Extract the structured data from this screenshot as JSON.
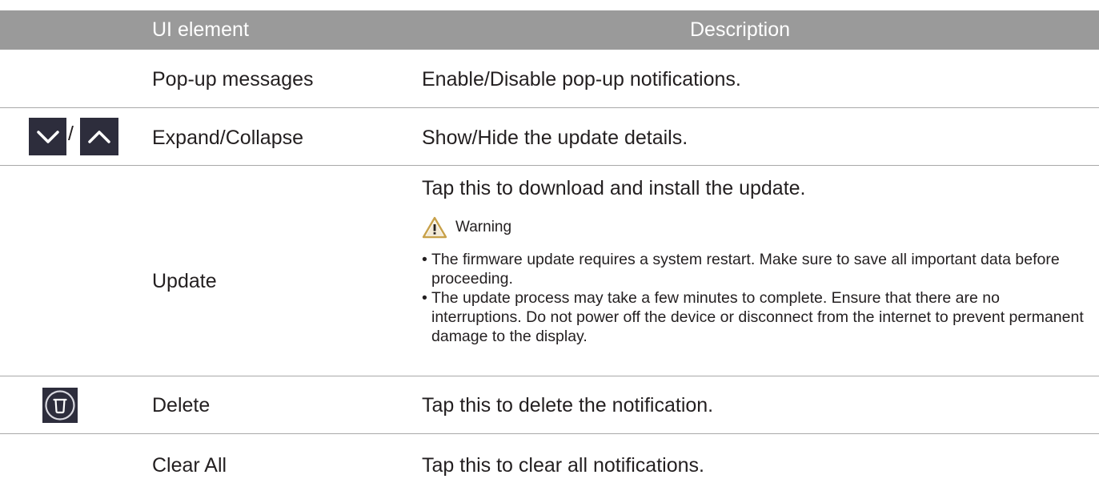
{
  "header": {
    "ui_element": "UI element",
    "description": "Description"
  },
  "rows": [
    {
      "ui_element": "Pop-up messages",
      "description": "Enable/Disable pop-up notifications."
    },
    {
      "icon": [
        "chevron-down-icon",
        "chevron-up-icon"
      ],
      "separator": "/",
      "ui_element": "Expand/Collapse",
      "description": "Show/Hide the update details."
    },
    {
      "ui_element": "Update",
      "description": "Tap this to download and install the update.",
      "warning_label": "Warning",
      "bullet_marker": "•",
      "bullets": [
        "The firmware update requires a system restart. Make sure to save all important data before proceeding.",
        "The update process may take a few minutes to complete. Ensure that there are no interruptions. Do not power off the device or disconnect from the internet to prevent permanent damage to the display."
      ]
    },
    {
      "icon": "trash-icon",
      "ui_element": "Delete",
      "description": "Tap this to delete the notification."
    },
    {
      "ui_element": "Clear All",
      "description": "Tap this to clear all notifications."
    }
  ],
  "colors": {
    "header_bg": "#9a9a9a",
    "header_text": "#ffffff",
    "icon_bg": "#2d2d3c",
    "warning_icon": "#c8a14a",
    "divider": "#a9a9a9"
  }
}
